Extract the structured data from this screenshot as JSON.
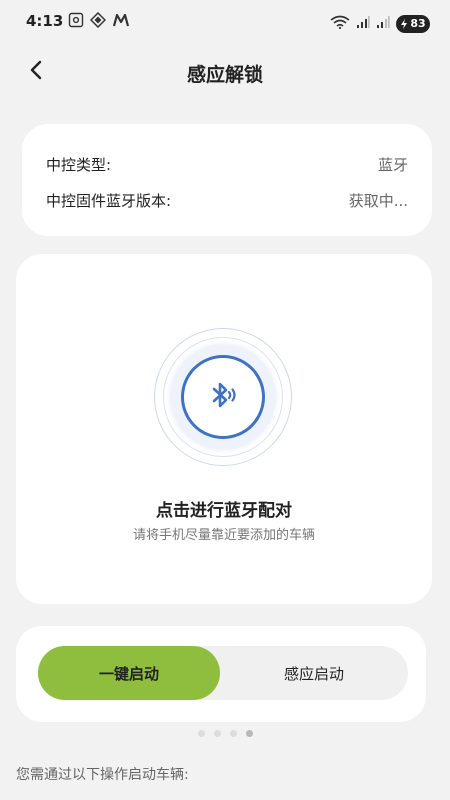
{
  "status_bar": {
    "time": "4:13",
    "battery": "83",
    "left_icons": [
      "screenshot-icon",
      "diamond-app-icon",
      "m-app-icon"
    ],
    "right_icons": [
      "wifi-icon",
      "signal-icon",
      "signal-icon-2",
      "battery-icon"
    ]
  },
  "header": {
    "back_icon": "chevron-left-icon",
    "title": "感应解锁"
  },
  "info_card": {
    "rows": [
      {
        "label": "中控类型:",
        "value": "蓝牙"
      },
      {
        "label": "中控固件蓝牙版本:",
        "value": "获取中..."
      }
    ]
  },
  "pair_card": {
    "icon": "bluetooth-icon",
    "title": "点击进行蓝牙配对",
    "subtitle": "请将手机尽量靠近要添加的车辆"
  },
  "mode_card": {
    "options": [
      {
        "label": "一键启动",
        "selected": true
      },
      {
        "label": "感应启动",
        "selected": false
      }
    ]
  },
  "pager": {
    "count": 4,
    "active_index": 3
  },
  "instruction": "您需通过以下操作启动车辆:",
  "colors": {
    "accent_green": "#8fbe3e",
    "bluetooth_blue": "#3f72c2",
    "background": "#f2f2f2"
  }
}
